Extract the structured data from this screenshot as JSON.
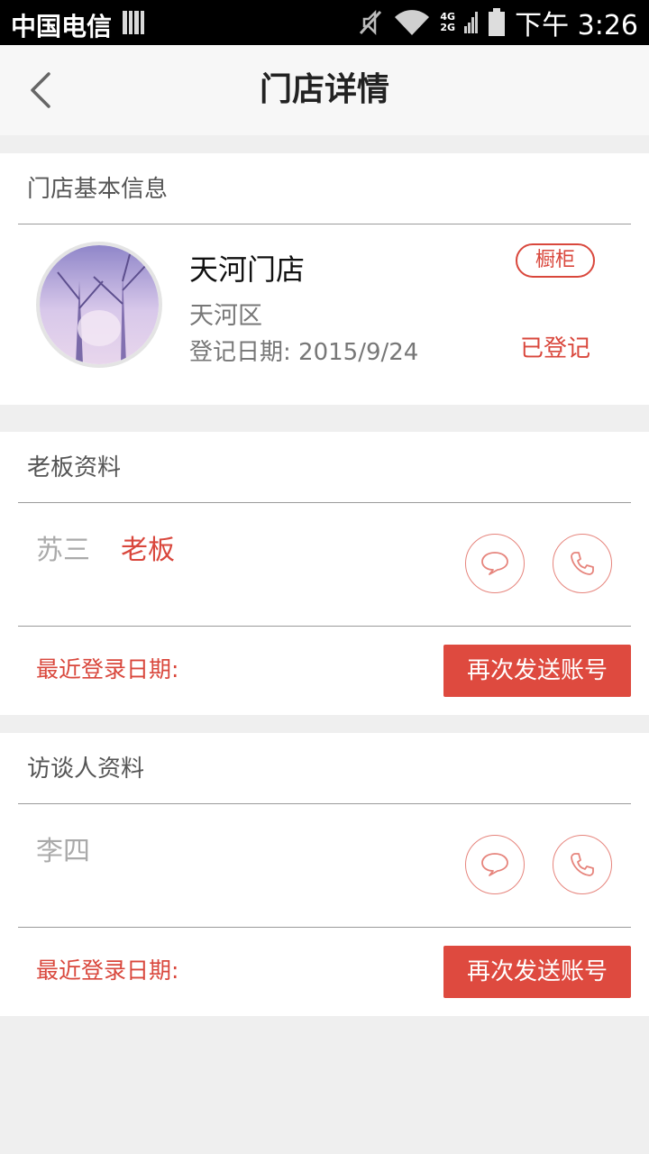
{
  "status_bar": {
    "carrier": "中国电信",
    "net_top": "4G",
    "net_bottom": "2G",
    "time": "下午 3:26"
  },
  "nav": {
    "title": "门店详情",
    "back_icon": "chevron-left-icon"
  },
  "store_card": {
    "header": "门店基本信息",
    "name": "天河门店",
    "district": "天河区",
    "date": "登记日期: 2015/9/24",
    "tag": "橱柜",
    "status": "已登记"
  },
  "boss_card": {
    "header": "老板资料",
    "name": "苏三",
    "role": "老板",
    "last_login": "最近登录日期:",
    "resend": "再次发送账号"
  },
  "interviewee_card": {
    "header": "访谈人资料",
    "name": "李四",
    "last_login": "最近登录日期:",
    "resend": "再次发送账号"
  },
  "colors": {
    "accent": "#d9473c",
    "button": "#de4a3f",
    "background": "#efefef"
  }
}
